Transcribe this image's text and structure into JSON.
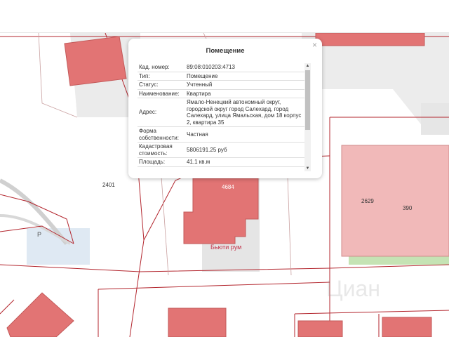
{
  "map": {
    "parcels": [
      "2401",
      "2629",
      "390",
      "4684"
    ],
    "poi": "Бьюти рум",
    "parking_glyph": "P",
    "watermark": "Циан",
    "colors": {
      "building": "#e27474",
      "building_stroke": "#c35a5a",
      "boundary": "#b3262e",
      "commercial": "#f1b9b9",
      "block": "#e9e9e9",
      "green": "#c5e3b4",
      "parking": "#dfe9f3"
    }
  },
  "popup": {
    "title": "Помещение",
    "close_glyph": "×",
    "rows": [
      {
        "key": "Кад. номер:",
        "value": "89:08:010203:4713"
      },
      {
        "key": "Тип:",
        "value": "Помещение"
      },
      {
        "key": "Статус:",
        "value": "Учтенный"
      },
      {
        "key": "Наименование:",
        "value": "Квартира"
      },
      {
        "key": "Адрес:",
        "value": "Ямало-Ненецкий автономный округ, городской округ город Салехард, город Салехард, улица Ямальская, дом 18 корпус 2, квартира 35"
      },
      {
        "key": "Форма собственности:",
        "value": "Частная"
      },
      {
        "key": "Кадастровая стоимость:",
        "value": "5806191.25 руб"
      },
      {
        "key": "Площадь:",
        "value": "41.1 кв.м"
      }
    ],
    "scroll_up_glyph": "▲",
    "scroll_down_glyph": "▼"
  }
}
